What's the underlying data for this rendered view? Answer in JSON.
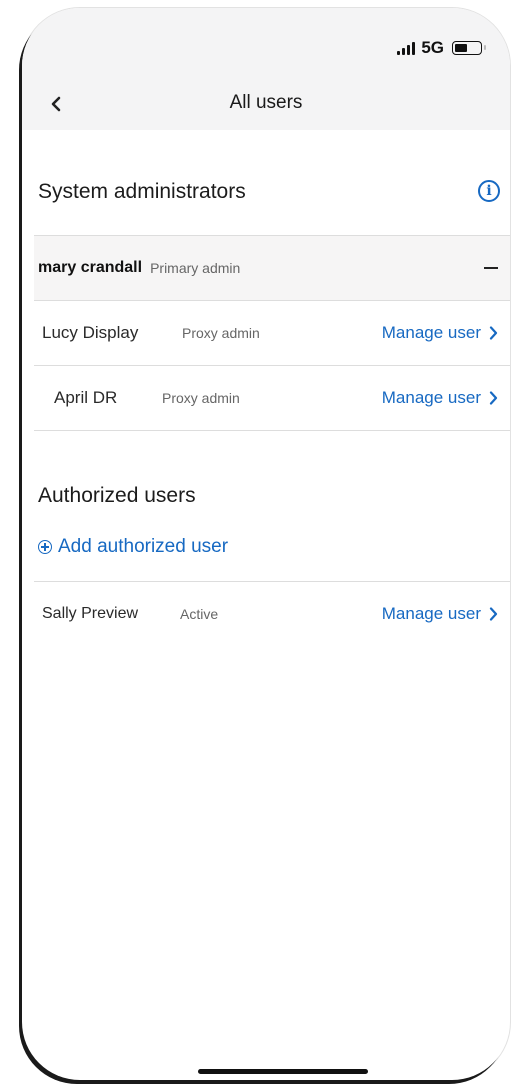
{
  "status_bar": {
    "network": "5G",
    "signal_icon": "cellular-signal-icon",
    "battery_icon": "battery-icon"
  },
  "header": {
    "title": "All users",
    "back_icon": "chevron-left-icon"
  },
  "system_admins": {
    "heading": "System administrators",
    "info_icon": "info-circle-icon",
    "primary": {
      "name": "mary crandall",
      "role": "Primary admin"
    },
    "proxies": [
      {
        "name": "Lucy Display",
        "role": "Proxy admin",
        "action": "Manage user"
      },
      {
        "name": "April DR",
        "role": "Proxy admin",
        "action": "Manage user"
      }
    ]
  },
  "authorized_users": {
    "heading": "Authorized users",
    "add_label": "Add authorized user",
    "users": [
      {
        "name": "Sally Preview",
        "status": "Active",
        "action": "Manage user"
      }
    ]
  },
  "colors": {
    "accent": "#1769c2",
    "header_bg": "#f4f4f5",
    "divider": "#dddddd"
  }
}
